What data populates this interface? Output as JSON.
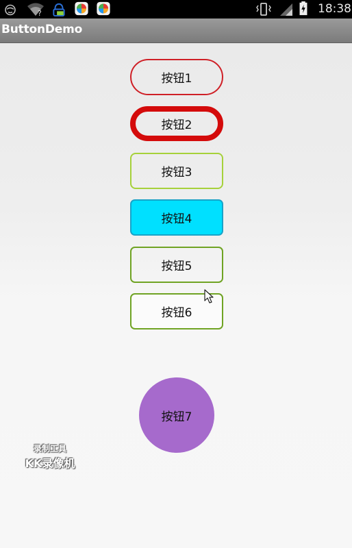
{
  "status_bar": {
    "time": "18:38",
    "icons": [
      "face-icon",
      "wifi-icon",
      "notification-icon",
      "app-icon",
      "app-icon",
      "vibrate-icon",
      "signal-icon",
      "battery-icon"
    ]
  },
  "app_bar": {
    "title": "ButtonDemo"
  },
  "buttons": [
    {
      "label": "按钮1"
    },
    {
      "label": "按钮2"
    },
    {
      "label": "按钮3"
    },
    {
      "label": "按钮4"
    },
    {
      "label": "按钮5"
    },
    {
      "label": "按钮6"
    },
    {
      "label": "按钮7"
    }
  ],
  "watermark": {
    "line1": "录制工具",
    "line2": "KK录像机"
  },
  "colors": {
    "button1_border": "#cf1f26",
    "button2_border": "#d40b0b",
    "button3_border": "#a6d13a",
    "button4_fill": "#00e0ff",
    "button5_border": "#6fa323",
    "button6_border": "#6fa323",
    "button7_fill": "#a66acc"
  }
}
